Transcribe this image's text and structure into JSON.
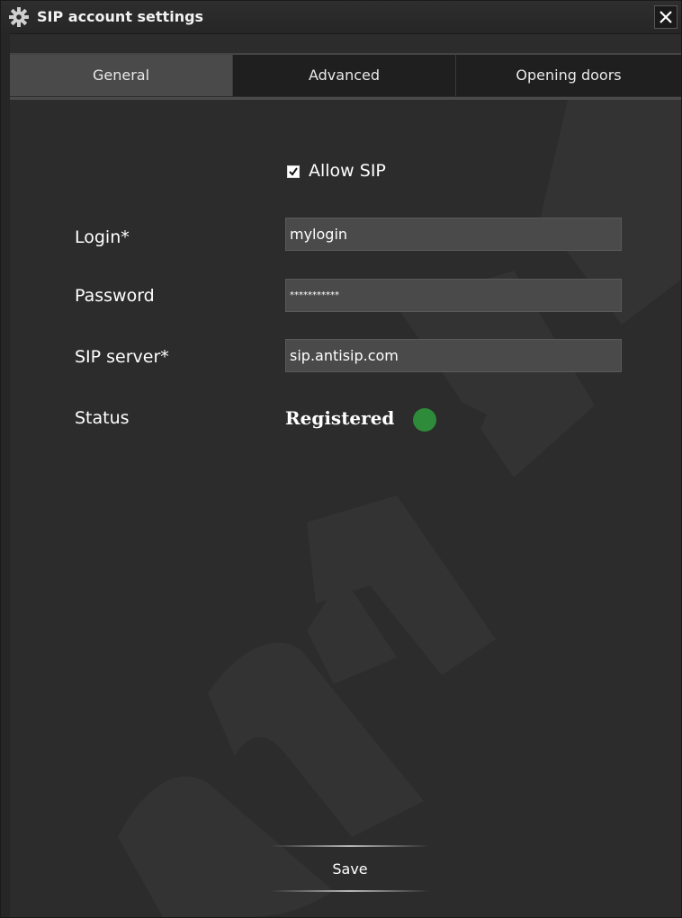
{
  "window": {
    "title": "SIP account settings",
    "title_icon": "gear-icon",
    "close_icon": "close-icon"
  },
  "tabs": [
    {
      "label": "General",
      "active": true
    },
    {
      "label": "Advanced",
      "active": false
    },
    {
      "label": "Opening doors",
      "active": false
    }
  ],
  "form": {
    "allow_sip": {
      "label": "Allow SIP",
      "checked": true
    },
    "login": {
      "label": "Login*",
      "value": "mylogin"
    },
    "password": {
      "label": "Password",
      "value": "***********"
    },
    "sip_server": {
      "label": "SIP server*",
      "value": "sip.antisip.com"
    },
    "status": {
      "label": "Status",
      "value": "Registered",
      "indicator_color": "#2e8b3a"
    }
  },
  "actions": {
    "save_label": "Save"
  },
  "colors": {
    "background": "#2c2c2c",
    "tab_active": "#4a4a4a",
    "input_bg": "#4a4a4a",
    "status_ok": "#2e8b3a"
  }
}
